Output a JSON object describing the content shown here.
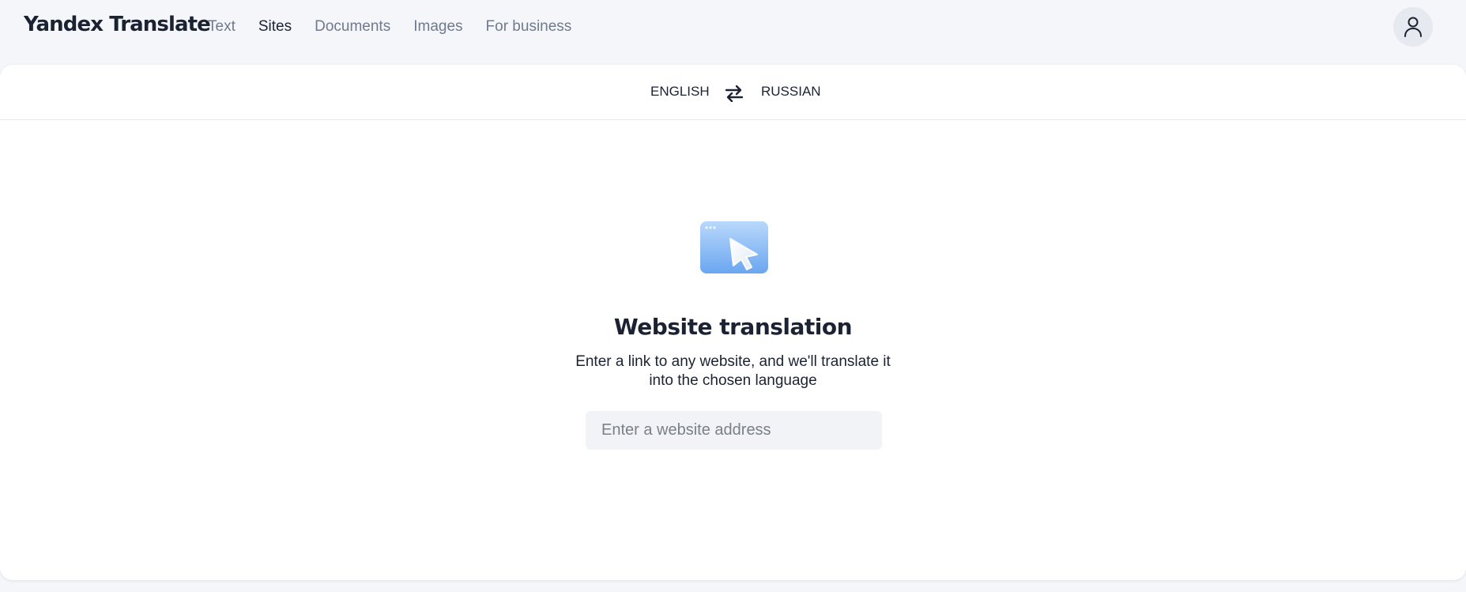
{
  "header": {
    "logo": "Yandex Translate",
    "nav": [
      {
        "label": "Text",
        "active": false
      },
      {
        "label": "Sites",
        "active": true
      },
      {
        "label": "Documents",
        "active": false
      },
      {
        "label": "Images",
        "active": false
      },
      {
        "label": "For business",
        "active": false
      }
    ],
    "profile_icon": "user-icon"
  },
  "language_bar": {
    "source": "ENGLISH",
    "target": "RUSSIAN",
    "swap_icon": "swap-arrows-icon"
  },
  "main": {
    "illustration_icon": "browser-window-cursor-icon",
    "title": "Website translation",
    "subtitle": "Enter a link to any website, and we'll translate it into the chosen language",
    "url_input": {
      "value": "",
      "placeholder": "Enter a website address"
    }
  },
  "colors": {
    "background": "#f5f6fa",
    "card": "#ffffff",
    "text": "#1b2333",
    "muted_text": "#6f7a8c",
    "input_bg": "#f2f3f6",
    "illustration_blue": "#7fb5f5"
  }
}
